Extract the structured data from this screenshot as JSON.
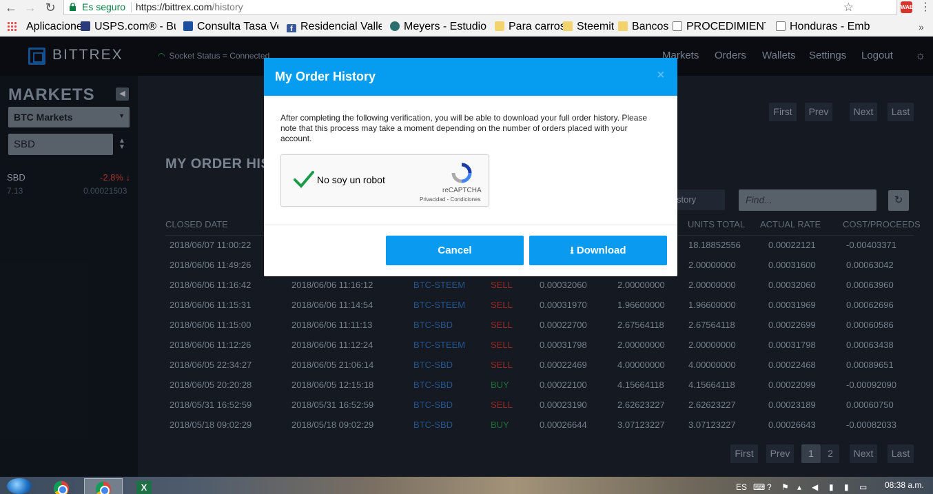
{
  "browser": {
    "secure_label": "Es seguro",
    "url_host": "https://bittrex.com",
    "url_path": "/history",
    "ext_badge": "WAE",
    "bookmarks": [
      {
        "label": "Aplicaciones",
        "color": "#e44"
      },
      {
        "label": "USPS.com® - Búsqu",
        "color": "#2a3a7a"
      },
      {
        "label": "Consulta Tasa Vehic",
        "color": "#1c4fa0"
      },
      {
        "label": "Residencial Valle Esc",
        "color": "#3b5998"
      },
      {
        "label": "Meyers - Estudio de",
        "color": "#2b6e6e"
      },
      {
        "label": "Para carros",
        "color": "#f3d36b"
      },
      {
        "label": "Steemit",
        "color": "#f3d36b"
      },
      {
        "label": "Bancos",
        "color": "#f3d36b"
      },
      {
        "label": "PROCEDIMIENTO PA",
        "color": "#ffffff"
      },
      {
        "label": "Honduras - Embajad",
        "color": "#ffffff"
      }
    ]
  },
  "header": {
    "logo": "BITTREX",
    "socket_status": "Socket Status = Connected",
    "nav": [
      "Markets",
      "Orders",
      "Wallets",
      "Settings",
      "Logout"
    ]
  },
  "sidebar": {
    "title": "MARKETS",
    "market_select": "BTC Markets",
    "search_value": "SBD",
    "coin": {
      "name": "SBD",
      "change": "-2.8% ↓",
      "volume": "7.13",
      "price": "0.00021503"
    }
  },
  "main": {
    "title": "MY ORDER HIS",
    "history_button": "story",
    "find_placeholder": "Find...",
    "pager_top": [
      "First",
      "Prev",
      "Next",
      "Last"
    ],
    "pager_bottom": [
      "First",
      "Prev",
      "1",
      "2",
      "Next",
      "Last"
    ],
    "columns": [
      "CLOSED DATE",
      "UNITS TOTAL",
      "ACTUAL RATE",
      "COST/PROCEEDS"
    ],
    "rows": [
      {
        "closed": "2018/06/07 11:00:22",
        "opened": "",
        "market": "",
        "type": "",
        "bid": "",
        "units_filled": "",
        "units_total": "18.18852556",
        "rate": "0.00022121",
        "cost": "-0.00403371"
      },
      {
        "closed": "2018/06/06 11:49:26",
        "opened": "",
        "market": "",
        "type": "",
        "bid": "",
        "units_filled": "",
        "units_total": "2.00000000",
        "rate": "0.00031600",
        "cost": "0.00063042"
      },
      {
        "closed": "2018/06/06 11:16:42",
        "opened": "2018/06/06 11:16:12",
        "market": "BTC-STEEM",
        "type": "SELL",
        "bid": "0.00032060",
        "units_filled": "2.00000000",
        "units_total": "2.00000000",
        "rate": "0.00032060",
        "cost": "0.00063960"
      },
      {
        "closed": "2018/06/06 11:15:31",
        "opened": "2018/06/06 11:14:54",
        "market": "BTC-STEEM",
        "type": "SELL",
        "bid": "0.00031970",
        "units_filled": "1.96600000",
        "units_total": "1.96600000",
        "rate": "0.00031969",
        "cost": "0.00062696"
      },
      {
        "closed": "2018/06/06 11:15:00",
        "opened": "2018/06/06 11:11:13",
        "market": "BTC-SBD",
        "type": "SELL",
        "bid": "0.00022700",
        "units_filled": "2.67564118",
        "units_total": "2.67564118",
        "rate": "0.00022699",
        "cost": "0.00060586"
      },
      {
        "closed": "2018/06/06 11:12:26",
        "opened": "2018/06/06 11:12:24",
        "market": "BTC-STEEM",
        "type": "SELL",
        "bid": "0.00031798",
        "units_filled": "2.00000000",
        "units_total": "2.00000000",
        "rate": "0.00031798",
        "cost": "0.00063438"
      },
      {
        "closed": "2018/06/05 22:34:27",
        "opened": "2018/06/05 21:06:14",
        "market": "BTC-SBD",
        "type": "SELL",
        "bid": "0.00022469",
        "units_filled": "4.00000000",
        "units_total": "4.00000000",
        "rate": "0.00022468",
        "cost": "0.00089651"
      },
      {
        "closed": "2018/06/05 20:20:28",
        "opened": "2018/06/05 12:15:18",
        "market": "BTC-SBD",
        "type": "BUY",
        "bid": "0.00022100",
        "units_filled": "4.15664118",
        "units_total": "4.15664118",
        "rate": "0.00022099",
        "cost": "-0.00092090"
      },
      {
        "closed": "2018/05/31 16:52:59",
        "opened": "2018/05/31 16:52:59",
        "market": "BTC-SBD",
        "type": "SELL",
        "bid": "0.00023190",
        "units_filled": "2.62623227",
        "units_total": "2.62623227",
        "rate": "0.00023189",
        "cost": "0.00060750"
      },
      {
        "closed": "2018/05/18 09:02:29",
        "opened": "2018/05/18 09:02:29",
        "market": "BTC-SBD",
        "type": "BUY",
        "bid": "0.00026644",
        "units_filled": "3.07123227",
        "units_total": "3.07123227",
        "rate": "0.00026643",
        "cost": "-0.00082033"
      }
    ]
  },
  "modal": {
    "title": "My Order History",
    "close": "×",
    "text": "After completing the following verification, you will be able to download your full order history. Please note that this process may take a moment depending on the number of orders placed with your account.",
    "captcha_label": "No soy un robot",
    "captcha_brand": "reCAPTCHA",
    "captcha_terms": "Privacidad - Condiciones",
    "cancel": "Cancel",
    "download": "Download"
  },
  "taskbar": {
    "lang": "ES",
    "time": "08:38 a.m."
  }
}
